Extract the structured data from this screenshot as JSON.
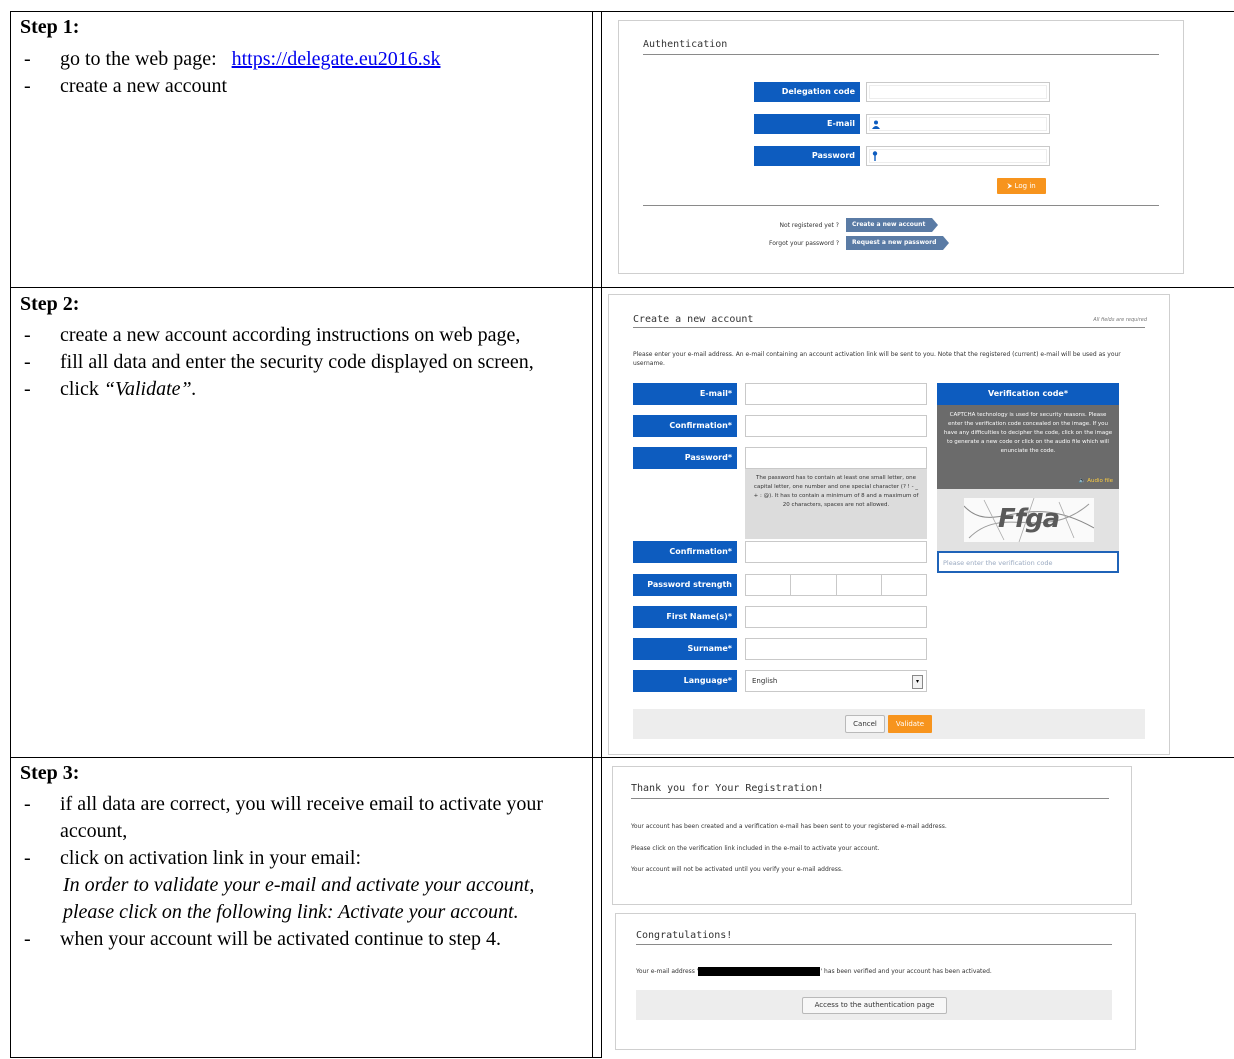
{
  "step1": {
    "heading": "Step 1:",
    "bullet1_text": "go to the web page:",
    "bullet1_link": "https://delegate.eu2016.sk",
    "bullet2": "create a new account"
  },
  "step2": {
    "heading": "Step 2:",
    "bullets": [
      "create a new account according instructions on web page,",
      "fill all data and enter the security code displayed on screen,"
    ],
    "bullet3_prefix": "click ",
    "bullet3_italic": "“Validate”."
  },
  "step3": {
    "heading": "Step 3:",
    "bullet1": "if all data are correct, you will receive email to activate your account,",
    "bullet2": "click on activation link in your email:",
    "quote": "In order to validate your e-mail and activate your account, please click on the following link: Activate your account.",
    "bullet3": "when your account will be activated continue to step 4."
  },
  "auth": {
    "title": "Authentication",
    "labels": [
      "Delegation code",
      "E-mail",
      "Password"
    ],
    "login_button": "Log in",
    "not_registered": "Not registered yet ?",
    "create_account": "Create a new account",
    "forgot": "Forgot your password ?",
    "request_password": "Request a new password",
    "brand_color": "#0d5cbf",
    "accent_color": "#f7941d"
  },
  "create": {
    "title": "Create a new account",
    "required_note": "All fields are required",
    "intro": "Please enter your e-mail address. An e-mail containing an account activation link will be sent to you. Note that the registered (current) e-mail will be used as your username.",
    "labels": {
      "email": "E-mail*",
      "confirmation1": "Confirmation*",
      "password": "Password*",
      "confirmation2": "Confirmation*",
      "strength": "Password strength",
      "first_name": "First Name(s)*",
      "surname": "Surname*",
      "language": "Language*"
    },
    "password_hint": "The password has to contain at least one small letter, one capital letter, one number and one special character (? ! - _ + : @). It has to contain a minimum of 8 and a maximum of 20 characters, spaces are not allowed.",
    "language_value": "English",
    "verification_title": "Verification code*",
    "captcha_info": "CAPTCHA technology is used for security reasons. Please enter the verification code concealed on the image. If you have any difficulties to decipher the code, click on the image to generate a new code or click on the audio file which will enunciate the code.",
    "audio_link": "Audio file",
    "captcha_text": "Ffga",
    "verification_placeholder": "Please enter the verification code",
    "cancel": "Cancel",
    "validate": "Validate"
  },
  "thanks": {
    "title": "Thank you for Your Registration!",
    "line1": "Your account has been created and a verification e-mail has been sent to your registered e-mail address.",
    "line2": "Please click on the verification link included in the e-mail to activate your account.",
    "line3": "Your account will not be activated until you verify your e-mail address."
  },
  "congrats": {
    "title": "Congratulations!",
    "prefix": "Your e-mail address '",
    "suffix": "' has been verified and your account has been activated.",
    "button": "Access to the authentication page"
  }
}
